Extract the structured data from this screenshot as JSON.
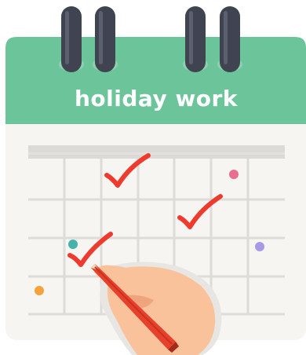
{
  "calendar": {
    "title": "holiday work",
    "header_color": "#6cc49b",
    "page_color": "#f6f5f2",
    "grid_color": "#dedcd8",
    "top_bar_color": "#dcdad7",
    "ring_color": "#3f4450",
    "ring_base_color": "#8fcfb0"
  },
  "marks": {
    "check_color": "#ef3b2d",
    "dot_colors": {
      "pink": "#e86f8e",
      "teal": "#45b3ab",
      "purple": "#a99ae6",
      "orange": "#f5a23a"
    }
  },
  "hand": {
    "skin_color": "#f9c29b",
    "shade_color": "#eea57e",
    "pencil_color": "#e8412b",
    "pencil_dark": "#a52a1c"
  }
}
